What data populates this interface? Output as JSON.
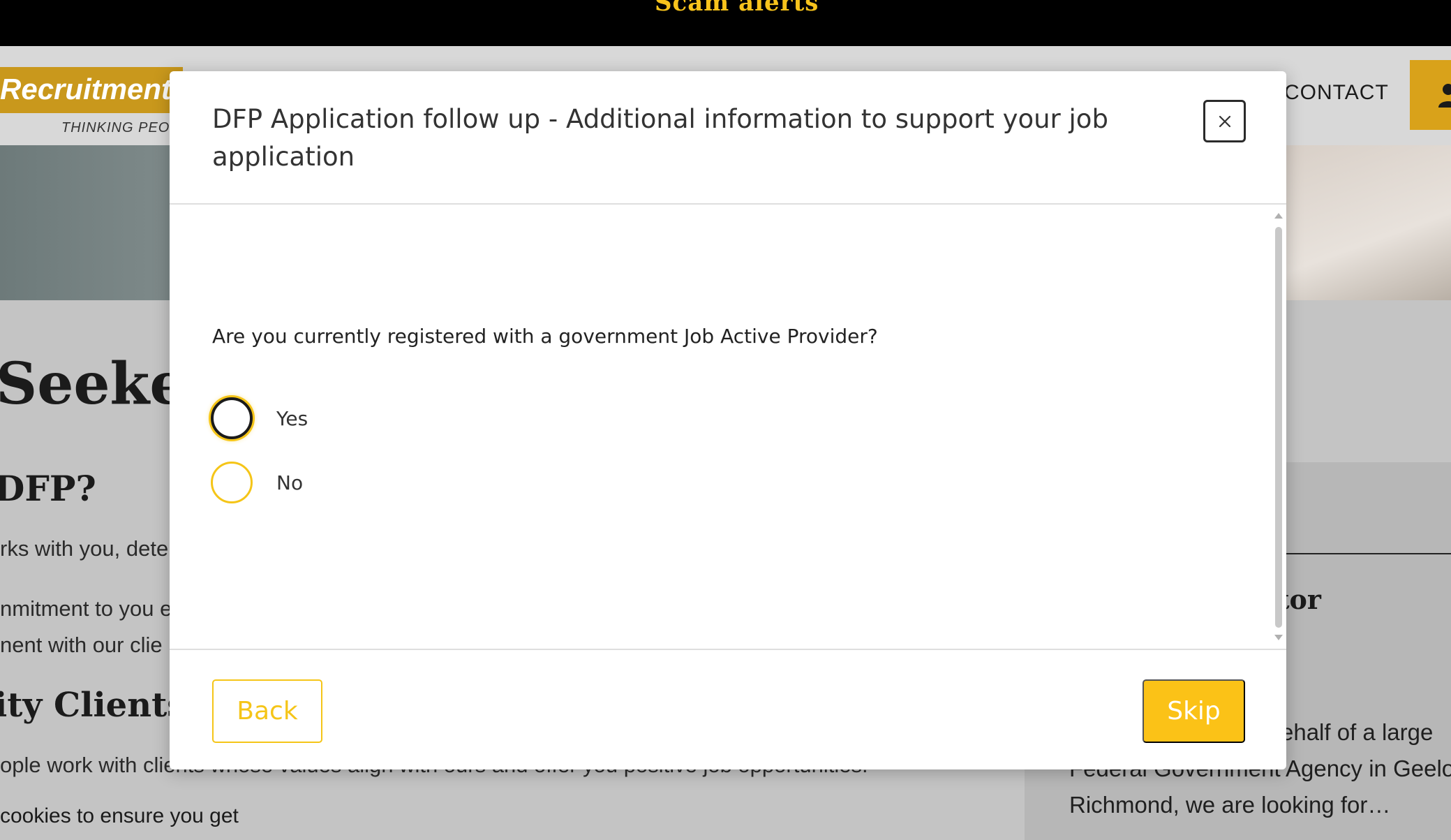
{
  "background_page": {
    "topbar_text": "Scam alerts",
    "logo": {
      "text": "Recruitment",
      "tagline": "THINKING PEOPL"
    },
    "nav": {
      "contact": "CONTACT",
      "user_icon": "user-icon"
    },
    "heading": "Seeke",
    "subheading": "DFP?",
    "paragraphs": [
      "rks with you, dete",
      "nmitment to you e",
      "nent with our clie"
    ],
    "subheading2": "ity Clients",
    "paragraph4": "ople work with clients whose values align with ours and offer you positive job opportunities.",
    "cookie_text": "cookies to ensure you get",
    "sidebar": {
      "title": "tor",
      "lines": [
        "ehalf of a large",
        "Federal Government Agency in Geelong",
        "Richmond, we are looking for…"
      ]
    }
  },
  "modal": {
    "title": "DFP Application follow up - Additional information to support your job application",
    "close_label": "×",
    "question": "Are you currently registered with a government Job Active Provider?",
    "options": [
      {
        "label": "Yes",
        "focused": true
      },
      {
        "label": "No",
        "focused": false
      }
    ],
    "back_label": "Back",
    "skip_label": "Skip"
  },
  "colors": {
    "accent": "#f5c518",
    "skip_bg": "#fbc217",
    "topbar": "#000000",
    "logo_band": "#c9981c"
  }
}
